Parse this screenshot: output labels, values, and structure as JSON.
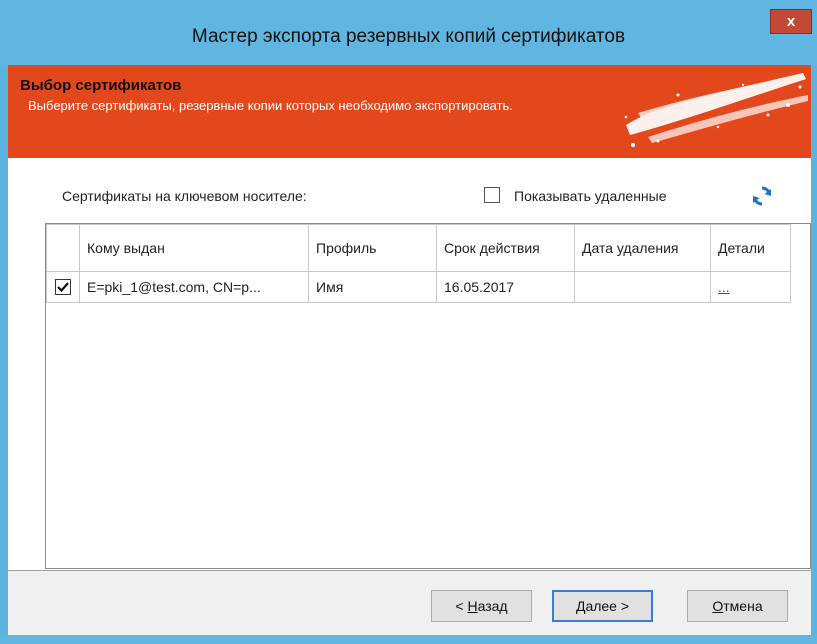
{
  "window": {
    "title": "Мастер экспорта резервных копий сертификатов",
    "close_label": "x"
  },
  "banner": {
    "title": "Выбор сертификатов",
    "description": "Выберите сертификаты, резервные копии которых необходимо экспортировать."
  },
  "main": {
    "cert_label": "Сертификаты на ключевом носителе:",
    "show_deleted_label": "Показывать удаленные",
    "show_deleted_checked": false
  },
  "table": {
    "columns": [
      "",
      "Кому выдан",
      "Профиль",
      "Срок действия",
      "Дата удаления",
      "Детали"
    ],
    "rows": [
      {
        "checked": true,
        "issued_to": "E=pki_1@test.com, CN=p...",
        "profile": "Имя",
        "validity": "16.05.2017",
        "deleted_date": "",
        "details": "..."
      }
    ]
  },
  "buttons": {
    "back_accel": "Н",
    "back_prefix": "< ",
    "back_rest": "азад",
    "next_accel": "Д",
    "next_rest": "алее >",
    "cancel_accel": "О",
    "cancel_rest": "тмена"
  },
  "colors": {
    "titlebar": "#61b6e1",
    "banner": "#e3481d",
    "close": "#c44a38",
    "link": "#1a4fbf",
    "refresh_icon": "#1a73c9"
  },
  "icons": {
    "close": "close-icon",
    "refresh": "refresh-icon",
    "checkbox": "checkmark-icon",
    "banner_decor": "brush-stroke-decoration"
  }
}
